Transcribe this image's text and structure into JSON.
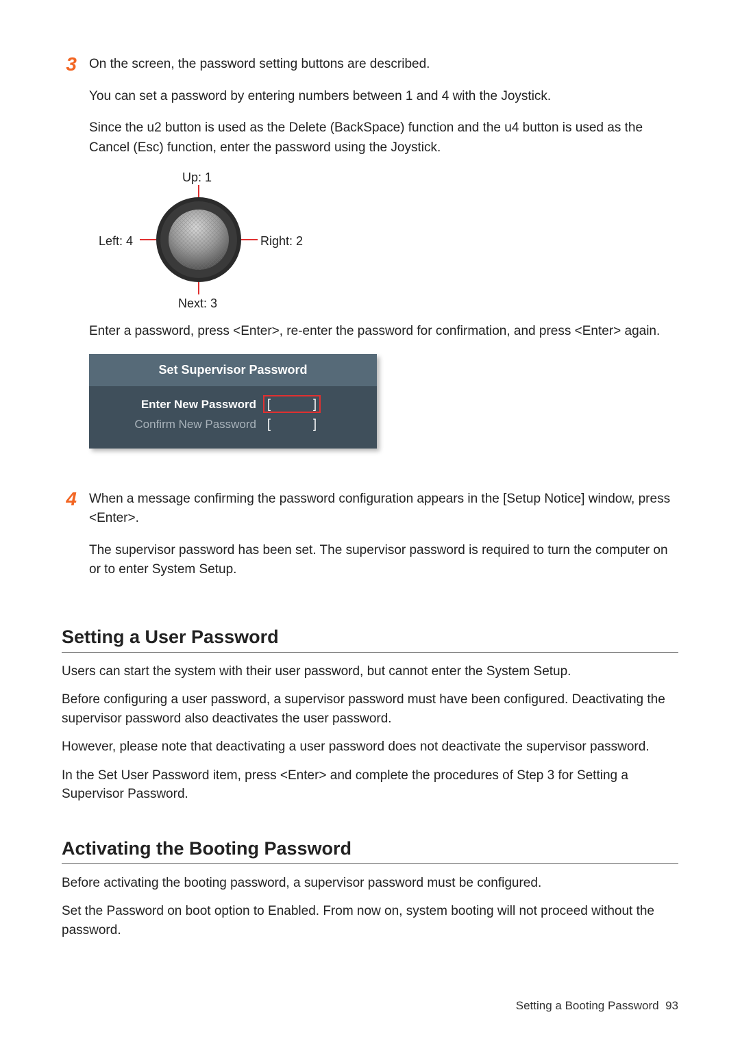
{
  "steps": {
    "s3": {
      "num": "3",
      "p1": "On the screen, the password setting buttons are described.",
      "p2": "You can set a password by entering numbers between 1 and 4 with the Joystick.",
      "p3": "Since the u2 button is used as the Delete (BackSpace) function and the u4 button is used as the Cancel (Esc) function, enter the password using the Joystick.",
      "p4": "Enter a password, press <Enter>, re-enter the password for confirmation, and press <Enter> again."
    },
    "s4": {
      "num": "4",
      "p1": "When a message confirming the password configuration appears in the [Setup Notice] window, press <Enter>.",
      "p2": "The supervisor password has been set. The supervisor password is required to turn the computer on or to enter System Setup."
    }
  },
  "joystick": {
    "up": "Up: 1",
    "right": "Right: 2",
    "down": "Next: 3",
    "left": "Left: 4"
  },
  "bios": {
    "title": "Set Supervisor Password",
    "row1": "Enter New Password",
    "row2": "Confirm New Password",
    "bl": "[",
    "br": "]"
  },
  "sections": {
    "user_pw": {
      "heading": "Setting a User Password",
      "p1": "Users can start the system with their user password, but cannot enter the System Setup.",
      "p2": "Before configuring a user password, a supervisor password must have been configured. Deactivating the supervisor password also deactivates the user password.",
      "p3": "However, please note that deactivating a user password does not deactivate the supervisor password.",
      "p4": "In the Set User Password item, press <Enter> and complete the procedures of Step 3 for Setting a Supervisor Password."
    },
    "boot_pw": {
      "heading": "Activating the Booting Password",
      "p1": "Before activating the booting password, a supervisor password must be configured.",
      "p2": "Set the Password on boot option to Enabled. From now on, system booting will not proceed without the password."
    }
  },
  "footer": {
    "label": "Setting a Booting Password",
    "page": "93"
  }
}
